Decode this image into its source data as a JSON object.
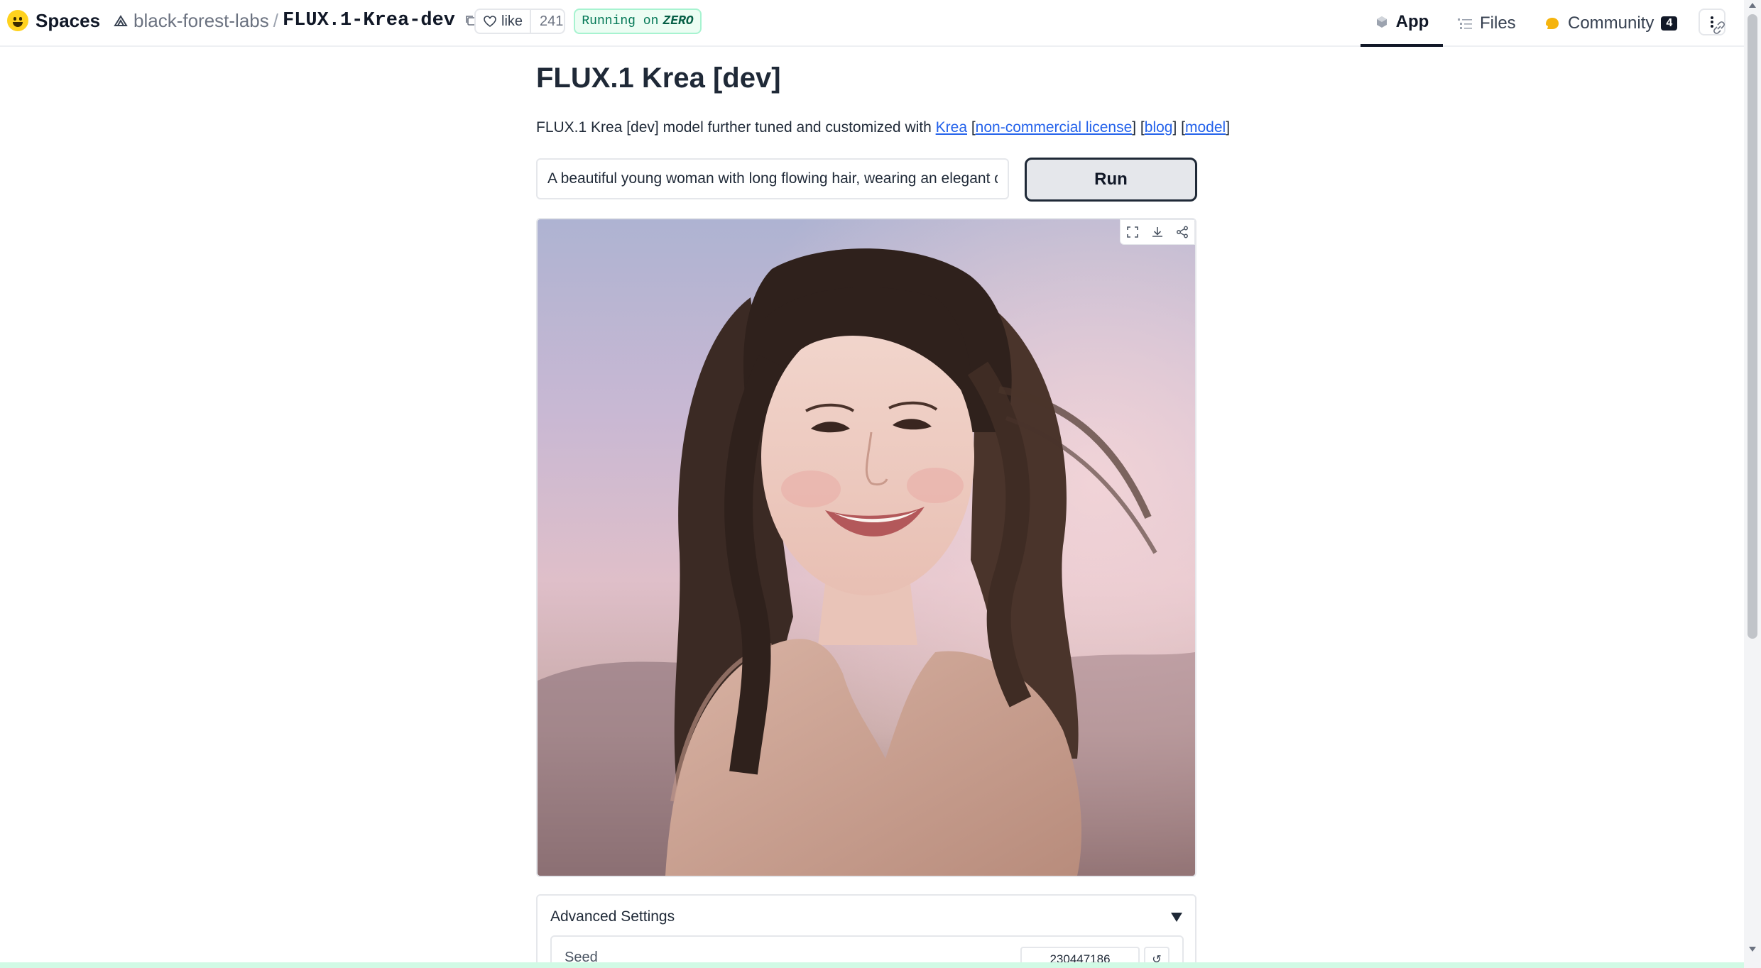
{
  "header": {
    "brand": "Spaces",
    "org": "black-forest-labs",
    "separator": "/",
    "repo": "FLUX.1-Krea-dev",
    "like_label": "like",
    "like_count": "241",
    "running_prefix": "Running on",
    "running_hw": "ZERO",
    "nav": {
      "app": "App",
      "files": "Files",
      "community": "Community",
      "community_count": "4"
    }
  },
  "main": {
    "title": "FLUX.1 Krea [dev]",
    "description_prefix": "FLUX.1 Krea [dev] model further tuned and customized with",
    "link_krea": "Krea",
    "link_license": "non-commercial license",
    "link_blog": "blog",
    "link_model": "model",
    "prompt_value": "A beautiful young woman with long flowing hair, wearing an elegant dres",
    "run_label": "Run",
    "image_alt": "Generated image",
    "advanced": {
      "label": "Advanced Settings",
      "seed_label": "Seed",
      "seed_value": "230447186"
    }
  },
  "colors": {
    "accent": "#2563eb",
    "running_bg": "#ecfdf3",
    "running_text": "#047857"
  },
  "icons": [
    "hf-logo-icon",
    "org-icon",
    "copy-icon",
    "heart-icon",
    "app-cube-icon",
    "files-icon",
    "community-icon",
    "more-icon",
    "fullscreen-icon",
    "download-icon",
    "share-icon",
    "reset-icon"
  ]
}
